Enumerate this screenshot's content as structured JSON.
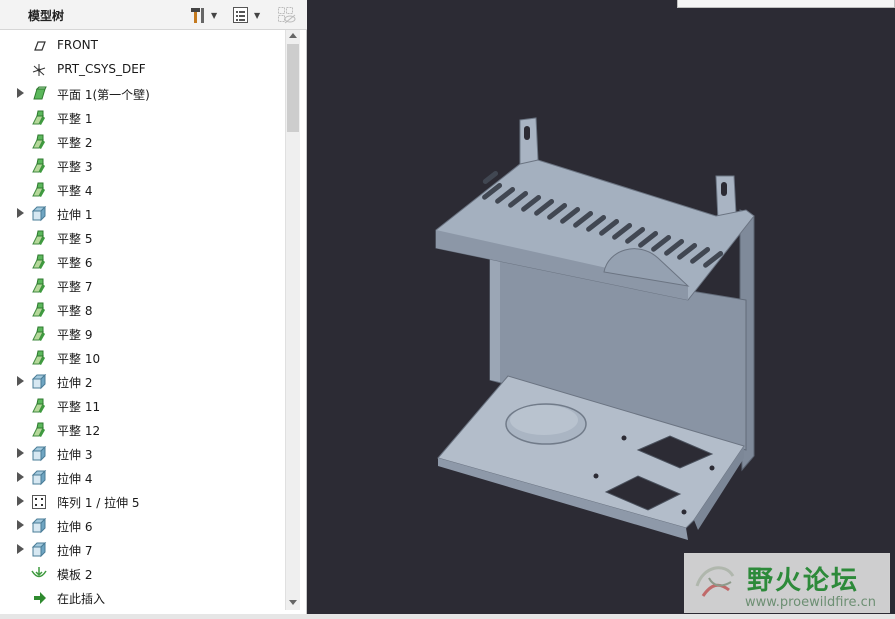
{
  "tree": {
    "title": "模型树",
    "items": [
      {
        "label": "FRONT",
        "icon": "datum-plane-icon",
        "expandable": false
      },
      {
        "label": "PRT_CSYS_DEF",
        "icon": "coordinate-system-icon",
        "expandable": false
      },
      {
        "label": "平面 1(第一个壁)",
        "icon": "planar-wall-icon",
        "expandable": true
      },
      {
        "label": "平整 1",
        "icon": "flat-wall-icon",
        "expandable": false
      },
      {
        "label": "平整 2",
        "icon": "flat-wall-icon",
        "expandable": false
      },
      {
        "label": "平整 3",
        "icon": "flat-wall-icon",
        "expandable": false
      },
      {
        "label": "平整 4",
        "icon": "flat-wall-icon",
        "expandable": false
      },
      {
        "label": "拉伸 1",
        "icon": "extrude-icon",
        "expandable": true
      },
      {
        "label": "平整 5",
        "icon": "flat-wall-icon",
        "expandable": false
      },
      {
        "label": "平整 6",
        "icon": "flat-wall-icon",
        "expandable": false
      },
      {
        "label": "平整 7",
        "icon": "flat-wall-icon",
        "expandable": false
      },
      {
        "label": "平整 8",
        "icon": "flat-wall-icon",
        "expandable": false
      },
      {
        "label": "平整 9",
        "icon": "flat-wall-icon",
        "expandable": false
      },
      {
        "label": "平整 10",
        "icon": "flat-wall-icon",
        "expandable": false
      },
      {
        "label": "拉伸 2",
        "icon": "extrude-icon",
        "expandable": true
      },
      {
        "label": "平整 11",
        "icon": "flat-wall-icon",
        "expandable": false
      },
      {
        "label": "平整 12",
        "icon": "flat-wall-icon",
        "expandable": false
      },
      {
        "label": "拉伸 3",
        "icon": "extrude-icon",
        "expandable": true
      },
      {
        "label": "拉伸 4",
        "icon": "extrude-icon",
        "expandable": true
      },
      {
        "label": "阵列 1 / 拉伸 5",
        "icon": "pattern-icon",
        "expandable": true
      },
      {
        "label": "拉伸 6",
        "icon": "extrude-icon",
        "expandable": true
      },
      {
        "label": "拉伸 7",
        "icon": "extrude-icon",
        "expandable": true
      },
      {
        "label": "模板 2",
        "icon": "form-icon",
        "expandable": false
      },
      {
        "label": "在此插入",
        "icon": "insert-here-icon",
        "expandable": false
      }
    ]
  },
  "watermark": {
    "title": "野火论坛",
    "url": "www.proewildfire.cn"
  },
  "colors": {
    "viewport_bg": "#2c2b34",
    "part_top": "#a4b0bf",
    "part_wall": "#8b96a6",
    "part_floor": "#b3bdca",
    "expand_arrow": "#555555",
    "icon_green": "#3f9a3f"
  }
}
